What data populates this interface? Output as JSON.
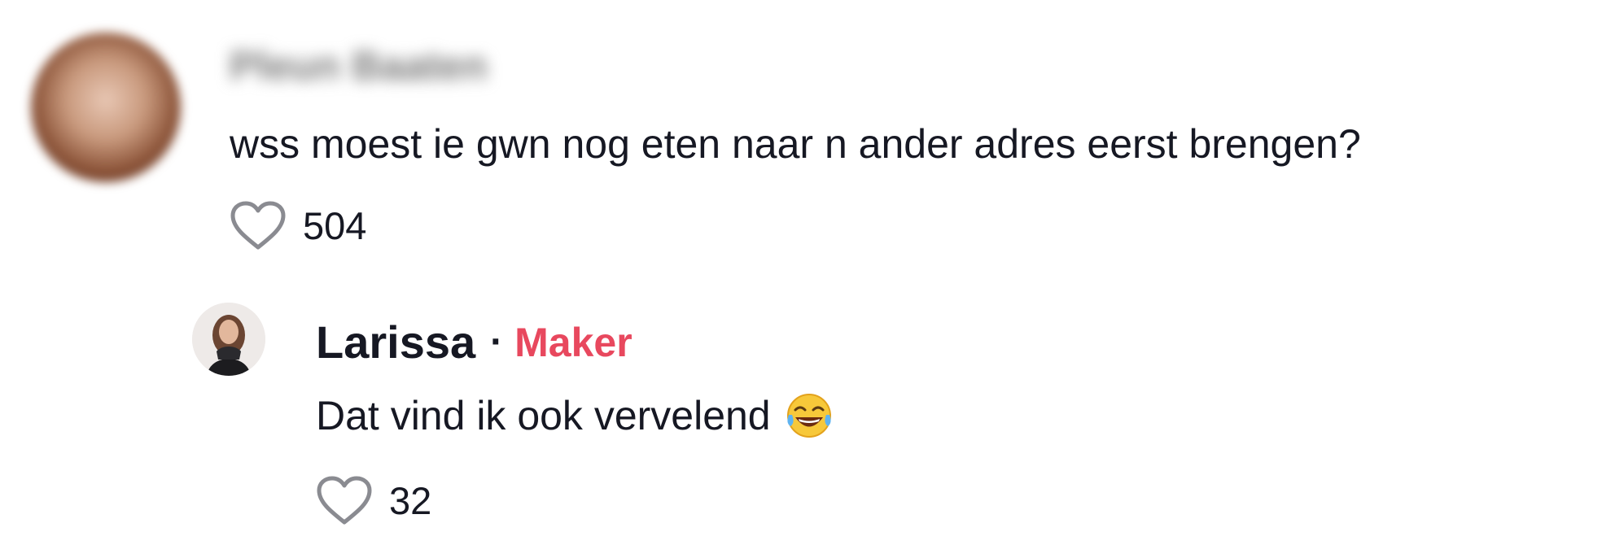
{
  "comments": [
    {
      "username": "Pleun Baaten",
      "text": "wss moest ie gwn nog eten naar n ander adres eerst brengen?",
      "likes": "504",
      "like_icon": "heart-outline-icon"
    }
  ],
  "reply": {
    "username": "Larissa",
    "separator": "·",
    "badge": "Maker",
    "badge_color": "#e8485e",
    "text": "Dat vind ik ook vervelend",
    "emoji": "face-with-tears-of-joy-icon",
    "likes": "32",
    "like_icon": "heart-outline-icon"
  },
  "colors": {
    "text": "#161823",
    "icon_gray": "#8a8b91"
  }
}
